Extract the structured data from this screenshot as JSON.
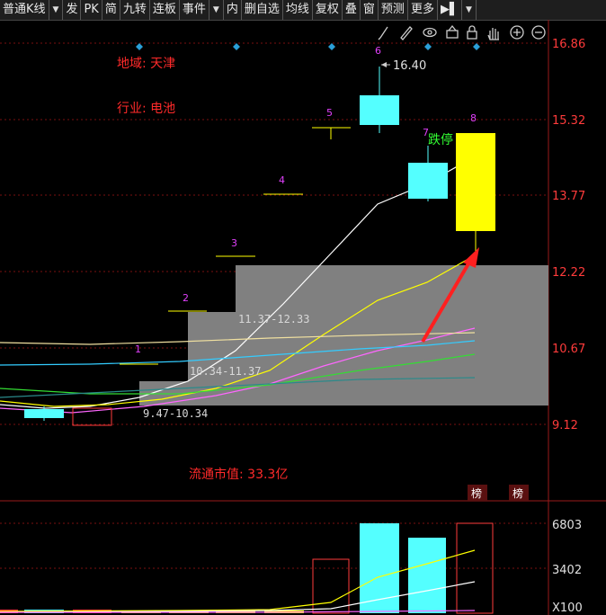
{
  "toolbar": {
    "items": [
      "普通K线",
      "▼",
      "发",
      "PK",
      "简",
      "九转",
      "连板",
      "事件",
      "▼",
      "内",
      "删自选",
      "均线",
      "复权",
      "叠",
      "窗",
      "预测",
      "更多",
      "▶▌",
      "▼"
    ]
  },
  "price_axis": {
    "labels": [
      "16.86",
      "15.32",
      "13.77",
      "12.22",
      "10.67",
      "9.12"
    ]
  },
  "volume_axis": {
    "labels": [
      "6803",
      "3402",
      "X100"
    ]
  },
  "info": {
    "region": "地域: 天津",
    "industry": "行业: 电池",
    "market_cap": "流通市值: 33.3亿",
    "high_label": "16.40",
    "limit_down": "跌停",
    "bang1": "榜",
    "bang2": "榜"
  },
  "ranges": [
    "11.37-12.33",
    "10.34-11.37",
    "9.47-10.34"
  ],
  "candle_numbers": [
    "1",
    "2",
    "3",
    "4",
    "5",
    "6",
    "7",
    "8"
  ],
  "colors": {
    "up": "#ff3b3b",
    "down": "#54ffff",
    "limit": "#ffff00",
    "zone": "#808080",
    "marker": "#1e90ff"
  },
  "icons": [
    "brush-icon",
    "pencil-icon",
    "eye-icon",
    "basket-icon",
    "lock-icon",
    "hand-icon",
    "zoom-in-icon",
    "zoom-out-icon"
  ]
}
